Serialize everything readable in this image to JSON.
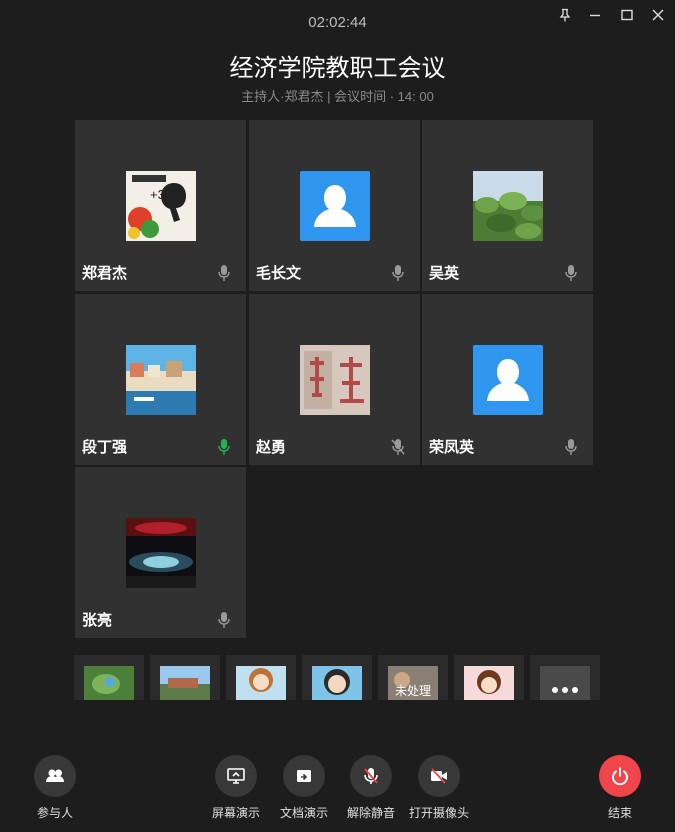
{
  "timer": "02:02:44",
  "meeting": {
    "title": "经济学院教职工会议",
    "subtitle": "主持人·郑君杰 | 会议时间 · 14: 00"
  },
  "window_controls": [
    "pin-icon",
    "minimize-icon",
    "maximize-icon",
    "close-icon"
  ],
  "participants": [
    {
      "name": "郑君杰",
      "avatar": "cartoon-photo",
      "mic": "normal"
    },
    {
      "name": "毛长文",
      "avatar": "default-user",
      "mic": "normal"
    },
    {
      "name": "吴英",
      "avatar": "leaves-photo",
      "mic": "normal"
    },
    {
      "name": "段丁强",
      "avatar": "waterfront-photo",
      "mic": "speaking"
    },
    {
      "name": "赵勇",
      "avatar": "calligraphy-photo",
      "mic": "muted"
    },
    {
      "name": "荣凤英",
      "avatar": "default-user",
      "mic": "normal"
    },
    {
      "name": "张亮",
      "avatar": "stage-photo",
      "mic": "normal"
    }
  ],
  "strip": [
    {
      "label": ""
    },
    {
      "label": ""
    },
    {
      "label": ""
    },
    {
      "label": ""
    },
    {
      "label": "未处理"
    },
    {
      "label": ""
    },
    {
      "label": ""
    }
  ],
  "controls": {
    "participants": "参与人",
    "screen_share": "屏幕演示",
    "doc_share": "文档演示",
    "unmute": "解除静音",
    "camera": "打开摄像头",
    "end": "结束"
  },
  "colors": {
    "background": "#1d1d1d",
    "tile": "#313131",
    "default_avatar": "#2e96ef",
    "speaking_mic": "#22b14c",
    "end_button": "#f0454a"
  }
}
